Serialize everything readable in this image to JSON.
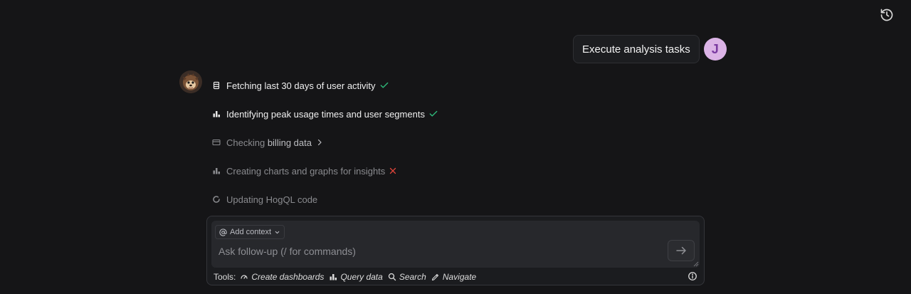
{
  "header": {
    "history_icon": "history-icon"
  },
  "user_message": {
    "text": "Execute analysis tasks",
    "avatar_initial": "J",
    "avatar_color": "#dbb3e6"
  },
  "assistant": {
    "avatar_icon": "hedgehog-avatar",
    "steps": [
      {
        "label": "Fetching last 30 days of user activity",
        "icon": "database-icon",
        "status": "success"
      },
      {
        "label": "Identifying peak usage times and user segments",
        "icon": "bar-chart-icon",
        "status": "success"
      },
      {
        "label_prefix": "Checking ",
        "label_highlight": "billing data",
        "icon": "billing-icon",
        "status": "expandable"
      },
      {
        "label": "Creating charts and graphs for insights",
        "icon": "bar-chart-icon",
        "status": "failed"
      },
      {
        "label": "Updating HogQL code",
        "icon": "loading-icon",
        "status": "in-progress"
      }
    ]
  },
  "composer": {
    "add_context_label": "Add context",
    "placeholder": "Ask follow-up (/ for commands)",
    "value": "",
    "tools_label": "Tools:",
    "tools": [
      {
        "label": "Create dashboards",
        "icon": "dashboard-icon"
      },
      {
        "label": "Query data",
        "icon": "bar-chart-icon"
      },
      {
        "label": "Search",
        "icon": "search-icon"
      },
      {
        "label": "Navigate",
        "icon": "navigate-icon"
      }
    ]
  },
  "colors": {
    "success": "#2fb87a",
    "error": "#e0443a",
    "background": "#151517"
  }
}
